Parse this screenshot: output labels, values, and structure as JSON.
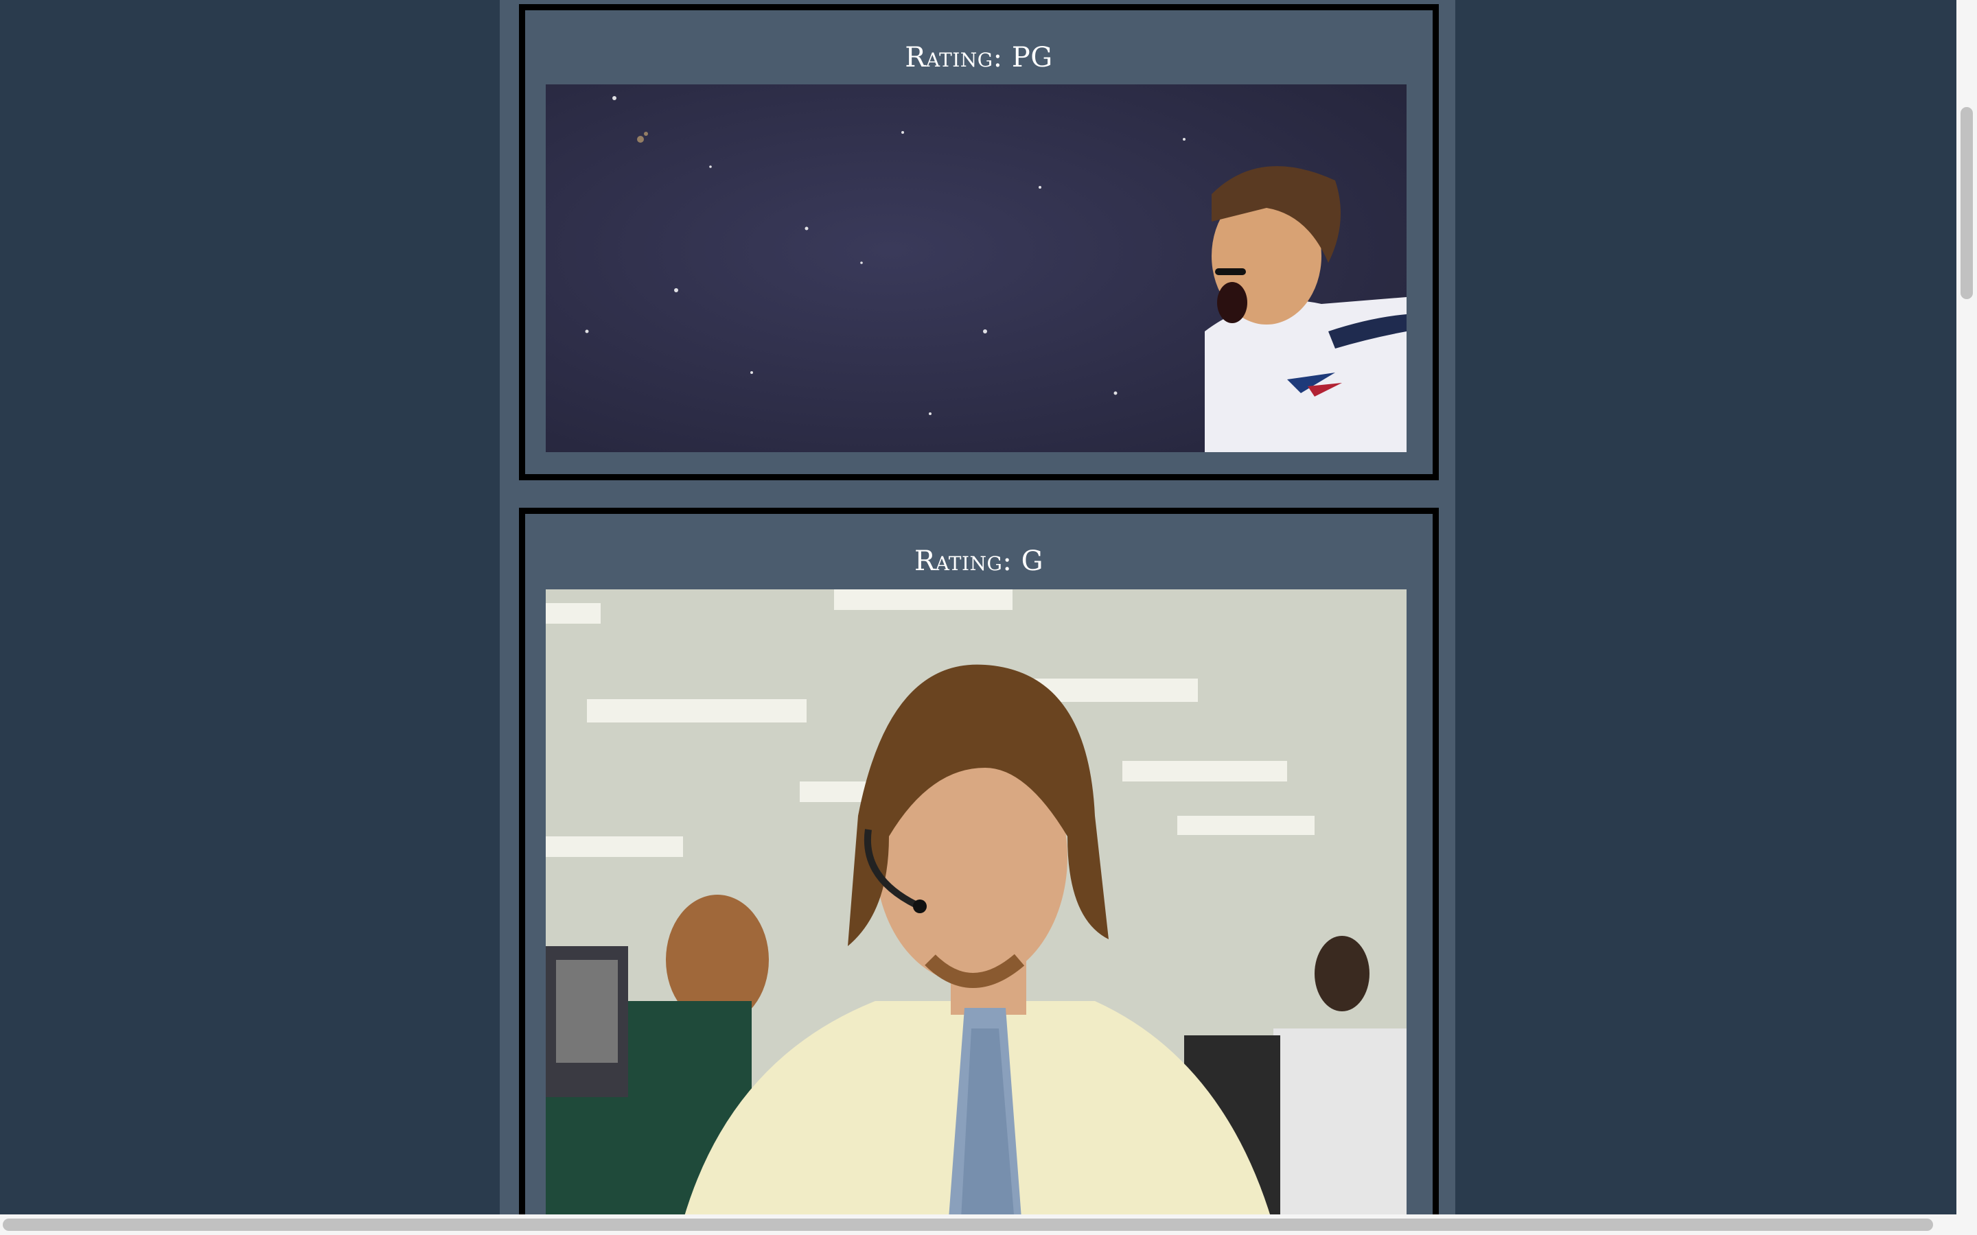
{
  "cards": [
    {
      "rating_label": "Rating: PG",
      "image_subject": "player-yelling-in-space-gif"
    },
    {
      "rating_label": "Rating: G",
      "image_subject": "office-worker-headset-gif"
    }
  ],
  "colors": {
    "page_background": "#2a3b4d",
    "column_background": "#4b5c6e",
    "card_border": "#000000",
    "title_text": "#ffffff"
  }
}
